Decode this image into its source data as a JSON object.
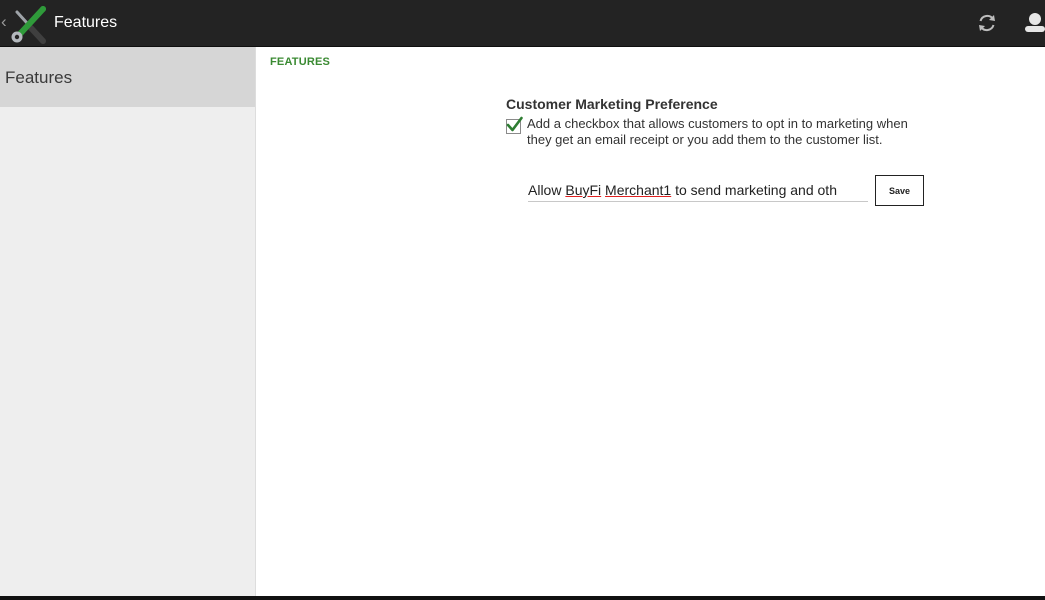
{
  "app": {
    "title": "Features",
    "back_glyph": "‹",
    "icon": "tools-icon"
  },
  "toolbar": {
    "refresh_icon": "refresh-icon",
    "account_icon": "account-icon"
  },
  "sidebar": {
    "items": [
      {
        "label": "Features",
        "selected": true
      }
    ]
  },
  "main": {
    "section_header": "FEATURES",
    "preference": {
      "title": "Customer Marketing Preference",
      "checked": true,
      "description": "Add a checkbox that allows customers to opt in to marketing when they get an email receipt or you add them to the customer list.",
      "message_parts": [
        "Allow ",
        "BuyFi",
        " ",
        "Merchant1",
        " to send marketing and oth"
      ],
      "save_label": "Save"
    }
  },
  "colors": {
    "topbar": "#232323",
    "accent_green": "#3a8a32",
    "sidebar_bg": "#eeeeee",
    "sidebar_selected": "#d6d6d6"
  }
}
